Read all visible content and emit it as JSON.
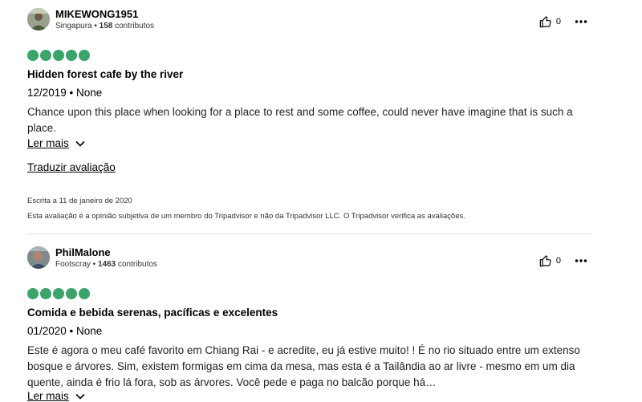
{
  "reviews": [
    {
      "username": "MIKEWONG1951",
      "location": "Singapura",
      "contrib_count": "158",
      "contrib_label": "contributos",
      "helpful_count": "0",
      "rating": 5,
      "title": "Hidden forest cafe by the river",
      "date": "12/2019 • None",
      "body": "Chance upon this place when looking for a place to rest and some coffee, could never have imagine that is such a place.",
      "read_more": "Ler mais",
      "translate": "Traduzir avaliação",
      "written": "Escrita a 11 de janeiro de 2020",
      "disclaimer": "Esta avaliação é a opinião subjetiva de um membro do Tripadvisor e não da Tripadvisor LLC. O Tripadvisor verifica as avaliações."
    },
    {
      "username": "PhilMalone",
      "location": "Footscray",
      "contrib_count": "1463",
      "contrib_label": "contributos",
      "helpful_count": "0",
      "rating": 5,
      "title": "Comida e bebida serenas, pacíficas e excelentes",
      "date": "01/2020 • None",
      "body": "Este é agora o meu café favorito em Chiang Rai - e acredite, eu já estive muito! ! É no rio situado entre um extenso bosque e árvores. Sim, existem formigas em cima da mesa, mas esta é a Tailândia ao ar livre - mesmo em um dia quente, ainda é frio lá fora, sob as árvores. Você pede e paga no balcão porque há…",
      "read_more": "Ler mais"
    }
  ],
  "colors": {
    "bubble": "#3aa46b",
    "divider": "#e0e0e0"
  },
  "icons": [
    "user-avatar",
    "thumbs-up-icon",
    "more-options-icon",
    "chevron-down-icon"
  ]
}
